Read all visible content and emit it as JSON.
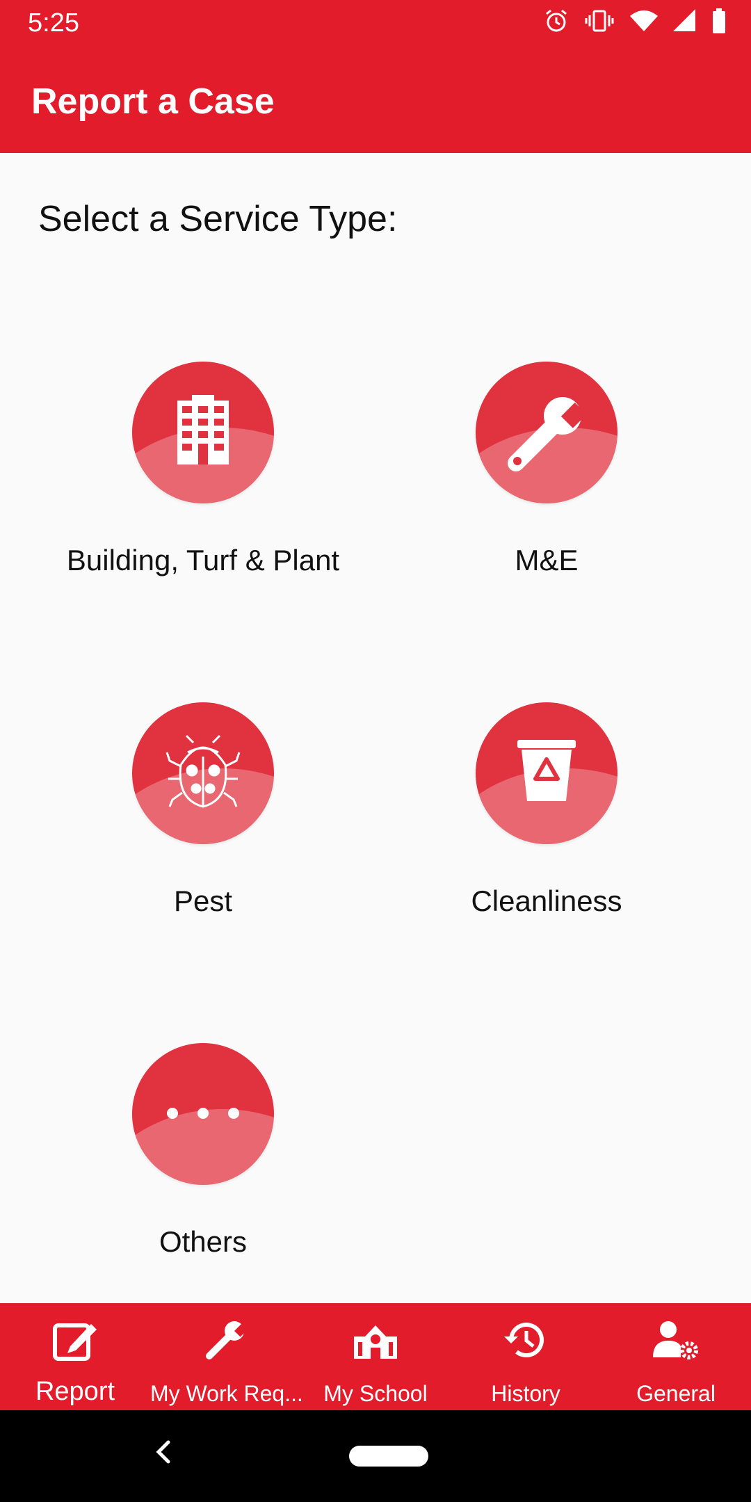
{
  "status_bar": {
    "time": "5:25",
    "icons": [
      "alarm-icon",
      "vibrate-icon",
      "wifi-icon",
      "signal-icon",
      "battery-icon"
    ]
  },
  "app_bar": {
    "title": "Report a Case"
  },
  "prompt": "Select a Service Type:",
  "services": [
    {
      "label": "Building, Turf & Plant",
      "icon": "building-icon"
    },
    {
      "label": "M&E",
      "icon": "wrench-icon"
    },
    {
      "label": "Pest",
      "icon": "bug-icon"
    },
    {
      "label": "Cleanliness",
      "icon": "recycle-bin-icon"
    },
    {
      "label": "Others",
      "icon": "more-dots-icon"
    }
  ],
  "bottom_nav": [
    {
      "label": "Report",
      "icon": "edit-icon",
      "active": true
    },
    {
      "label": "My Work Req...",
      "icon": "wrench-icon",
      "active": false
    },
    {
      "label": "My School",
      "icon": "school-icon",
      "active": false
    },
    {
      "label": "History",
      "icon": "history-icon",
      "active": false
    },
    {
      "label": "General",
      "icon": "user-settings-icon",
      "active": false
    }
  ],
  "colors": {
    "primary": "#e31c2b",
    "circle": "#e0323f",
    "background": "#fafafa"
  }
}
